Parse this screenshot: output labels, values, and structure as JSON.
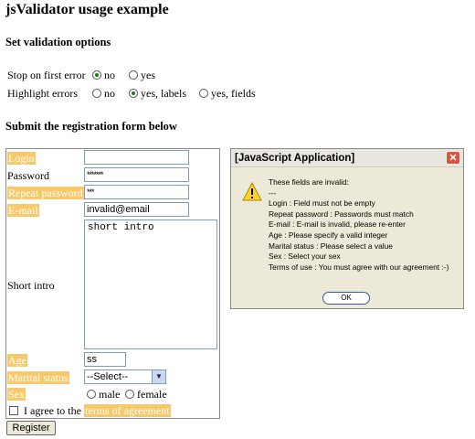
{
  "page": {
    "title": "jsValidator usage example",
    "options_heading": "Set validation options",
    "form_heading": "Submit the registration form below"
  },
  "options": {
    "stop_label": "Stop on first error",
    "stop_choices": [
      "no",
      "yes"
    ],
    "stop_selected": "no",
    "highlight_label": "Highlight errors",
    "highlight_choices": [
      "no",
      "yes, labels",
      "yes, fields"
    ],
    "highlight_selected": "yes, labels"
  },
  "form": {
    "login_label": "Login",
    "login_value": "",
    "password_label": "Password",
    "password_value": "*******",
    "repeat_label": "Repeat password",
    "repeat_value": "***",
    "email_label": "E-mail",
    "email_value": "invalid@email",
    "intro_label": "Short intro",
    "intro_value": "short intro",
    "age_label": "Age",
    "age_value": "ss",
    "marital_label": "Marital status",
    "marital_value": "--Select--",
    "sex_label": "Sex",
    "sex_choices": [
      "male",
      "female"
    ],
    "agree_prefix": "I agree to the",
    "agree_link": "terms of agreement",
    "register_label": "Register",
    "error_highlight_color": "#f7c96a"
  },
  "dialog": {
    "title": "[JavaScript Application]",
    "close_glyph": "✕",
    "icon": "warning-icon",
    "lines": [
      "These fields are invalid:",
      "---",
      "Login : Field must not be empty",
      "Repeat password : Passwords must match",
      "E-mail : E-mail is invalid, please re-enter",
      "Age : Please specify a valid integer",
      "Marital status : Please select a value",
      "Sex : Select your sex",
      "Terms of use : You must agree with our agreement :-)"
    ],
    "ok_label": "OK"
  }
}
